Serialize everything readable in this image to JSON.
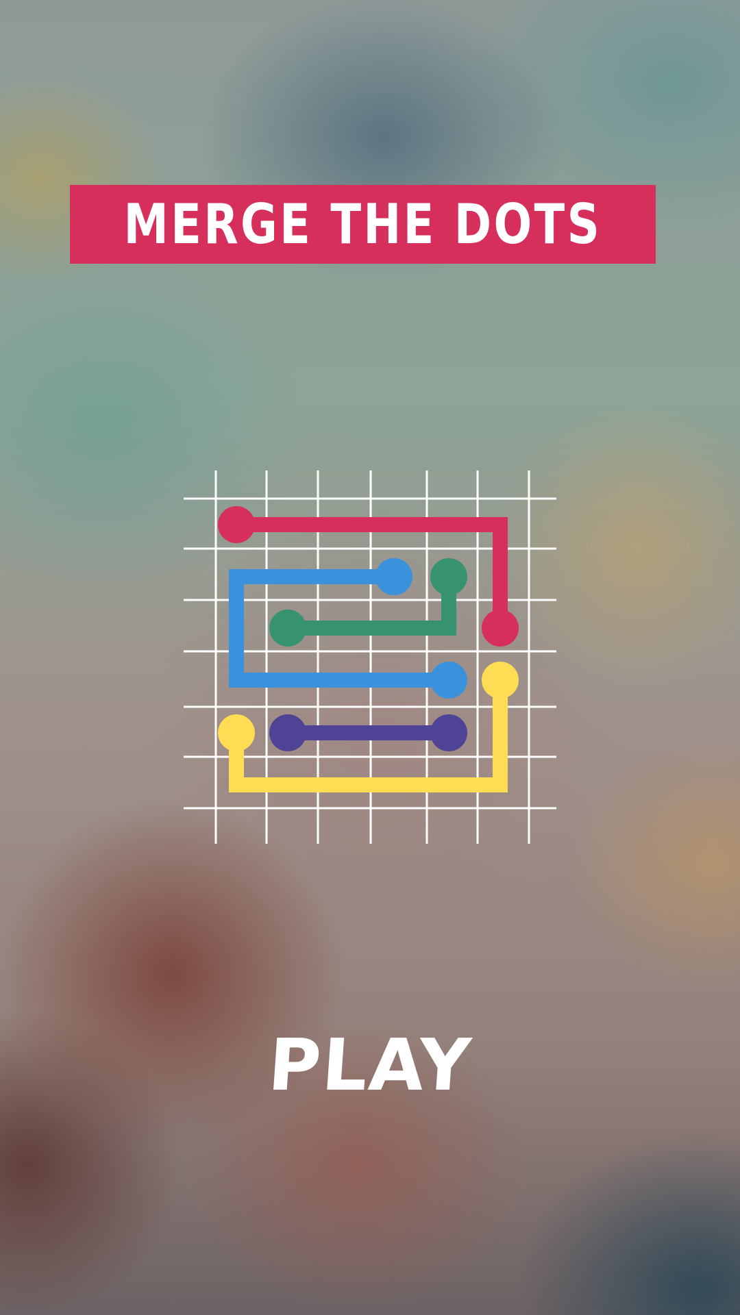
{
  "app": {
    "title": "MERGE THE DOTS"
  },
  "menu": {
    "play_label": "PLAY"
  },
  "colors": {
    "banner": "#d62f5b",
    "grid": "#ffffff",
    "red": "#d62f5b",
    "blue": "#3a92dc",
    "green": "#37926f",
    "yellow": "#fedd55",
    "purple": "#4e4394"
  },
  "board_preview": {
    "paths": [
      {
        "color": "red",
        "cells": [
          [
            0,
            0
          ],
          [
            5,
            0
          ],
          [
            5,
            2
          ]
        ]
      },
      {
        "color": "blue",
        "cells": [
          [
            3,
            1
          ],
          [
            0,
            1
          ],
          [
            0,
            3
          ],
          [
            4,
            3
          ]
        ]
      },
      {
        "color": "green",
        "cells": [
          [
            4,
            1
          ],
          [
            4,
            2
          ],
          [
            1,
            2
          ]
        ]
      },
      {
        "color": "purple",
        "cells": [
          [
            1,
            4
          ],
          [
            4,
            4
          ]
        ]
      },
      {
        "color": "yellow",
        "cells": [
          [
            0,
            4
          ],
          [
            0,
            5
          ],
          [
            5,
            5
          ],
          [
            5,
            3
          ]
        ]
      }
    ]
  }
}
